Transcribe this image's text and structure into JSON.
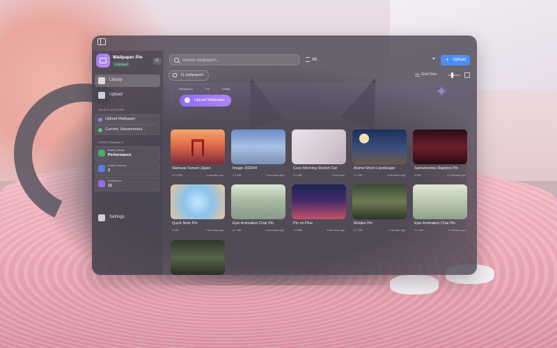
{
  "app": {
    "name": "Wallpaper Pin",
    "badge": "Licensed"
  },
  "sidebar": {
    "nav": [
      {
        "label": "Library",
        "active": true
      },
      {
        "label": "Upload",
        "active": false
      }
    ],
    "quick_actions_title": "QUICK ACTIONS",
    "quick_actions": [
      {
        "label": "Upload Wallpaper",
        "color": "#7b8cf0"
      },
      {
        "label": "Current: Salvamentos...",
        "color": "#5ac47f"
      }
    ],
    "performance_title": "PERFORMANCE",
    "performance": [
      {
        "label": "Battery Mode",
        "value": "Performance",
        "color": "#49a86d"
      },
      {
        "label": "Active Screens",
        "value": "2",
        "color": "#5a7fe0"
      },
      {
        "label": "Wallpapers",
        "value": "11",
        "color": "#9a6be0"
      }
    ],
    "settings_label": "Settings"
  },
  "toolbar": {
    "search_placeholder": "Search wallpapers...",
    "filter_label": "All",
    "upload_label": "Upload",
    "upload_color": "#4a8ff0"
  },
  "library": {
    "count_label": "11 wallpapers",
    "grid_size_label": "Grid Size",
    "grid_size_level": 0.35
  },
  "banner": {
    "tags": [
      "Wallpapers",
      "Live",
      "Quality"
    ],
    "button_label": "Upload Wallpaper"
  },
  "wallpapers": [
    {
      "name": "Samurai Sunset Japan",
      "size": "12.3 MB",
      "date": "4 minutes ago"
    },
    {
      "name": "Image 203244",
      "size": "3.4 MB",
      "date": "4 seconds ago"
    },
    {
      "name": "Cozy Morning Stretch Cat",
      "size": "4.1 MB",
      "date": "4 seconds"
    },
    {
      "name": "Anime Moon Landscape",
      "size": "2.1 MB",
      "date": "4 seconds ago"
    },
    {
      "name": "Salvamentos Rápidos Pin",
      "size": "3 MB",
      "date": "12 minutes ago"
    },
    {
      "name": "Quick Note Pin",
      "size": "3 MB",
      "date": "2 seconds ago"
    },
    {
      "name": "Epic Animation Char Pin",
      "size": "3.7 MB",
      "date": "4 seconds ago"
    },
    {
      "name": "Pin on Pine",
      "size": "4.8 MB",
      "date": "4 seconds ago"
    },
    {
      "name": "Moldes Pin",
      "size": "5.7 MB",
      "date": "2 minutes ago"
    },
    {
      "name": "Epic Animation Char Pin",
      "size": "3.1 MB",
      "date": "2 minutes ago"
    },
    {
      "name": "",
      "size": "",
      "date": ""
    }
  ]
}
